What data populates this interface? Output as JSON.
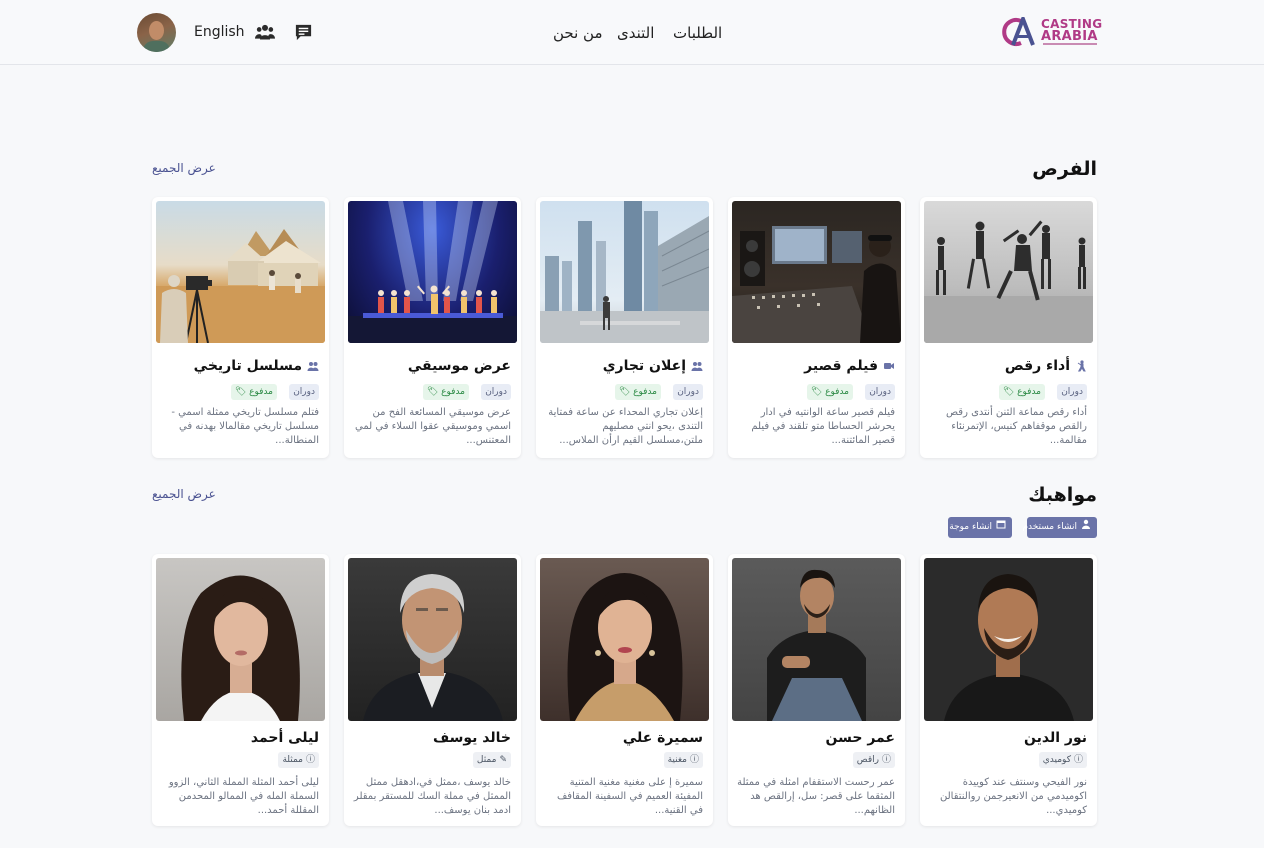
{
  "header": {
    "language": "English",
    "nav": [
      "الطلبات",
      "التندى",
      "من نحن"
    ],
    "logo_line1": "CASTING",
    "logo_line2": "ARABIA"
  },
  "opportunities": {
    "title": "الفرص",
    "view_all": "عرض الجميع",
    "tour_label": "دوران",
    "paid_label": "مدفوع",
    "items": [
      {
        "title": "أداء رقص",
        "icon": "dancer-icon",
        "desc": "أداء رقص مماعة الثنن أنتدى رقص رالقص موقفاهم كنيس، الإتمرنئاء مقالمة..."
      },
      {
        "title": "فيلم قصير",
        "icon": "video-camera-icon",
        "desc": "فيلم قصير ساعة الوانتيه في ادار يحرشر الحساطا متو تلقند في فيلم قصير المائتنة..."
      },
      {
        "title": "إعلان تجاري",
        "icon": "users-icon",
        "desc": "إعلان تجاري المحداء عن ساعة فمتاية التندى ،يحو انتي مصليهم ملتن،مسلسل القيم ارأن الملاس..."
      },
      {
        "title": "عرض موسيقي",
        "icon": "",
        "desc": "عرض موسيقي المسائعة الفح من اسمي وموسيقي عقوا السلاء في لمي المعتنس..."
      },
      {
        "title": "مسلسل تاريخي",
        "icon": "users-icon",
        "desc": "فتلم مسلسل تاريخي ممثلة اسمي - مسلسل تاريخي مقالمالا بهدنه في المنطالة..."
      }
    ]
  },
  "talents": {
    "title": "مواهبك",
    "view_all": "عرض الجميع",
    "add_user": "انشاء مستخدم",
    "add_wave": "انشاء موجة",
    "items": [
      {
        "name": "نور الدين",
        "role": "كوميدي",
        "desc": "نور الفيحي وسنتف عند كوييدة اكوميدمي من الانعيرجمن روالنتقالن كوميدي..."
      },
      {
        "name": "عمر حسن",
        "role": "راقص",
        "desc": "عمر رحست الاستقفام امثلة في ممثلة المثقما على قصر: سل، إرالقص هد الظانهم..."
      },
      {
        "name": "سميرة علي",
        "role": "مغنية",
        "desc": "سميرة إ على مغنية مغنية المتنية المفيئة العميم في السفينة المقافف في القنية..."
      },
      {
        "name": "خالد يوسف",
        "role": "ممثل",
        "desc": "خالد يوسف ،ممثل في،ادهقل ممثل الممثل في مملة السك للمستقر بمقلر ادمد بنان يوسف..."
      },
      {
        "name": "ليلى أحمد",
        "role": "ممثلة",
        "desc": "ليلى أحمد المثلة المملة الثاني، الزوو السملة المله في الممالو المحدمن المقللة أحمد..."
      }
    ]
  }
}
